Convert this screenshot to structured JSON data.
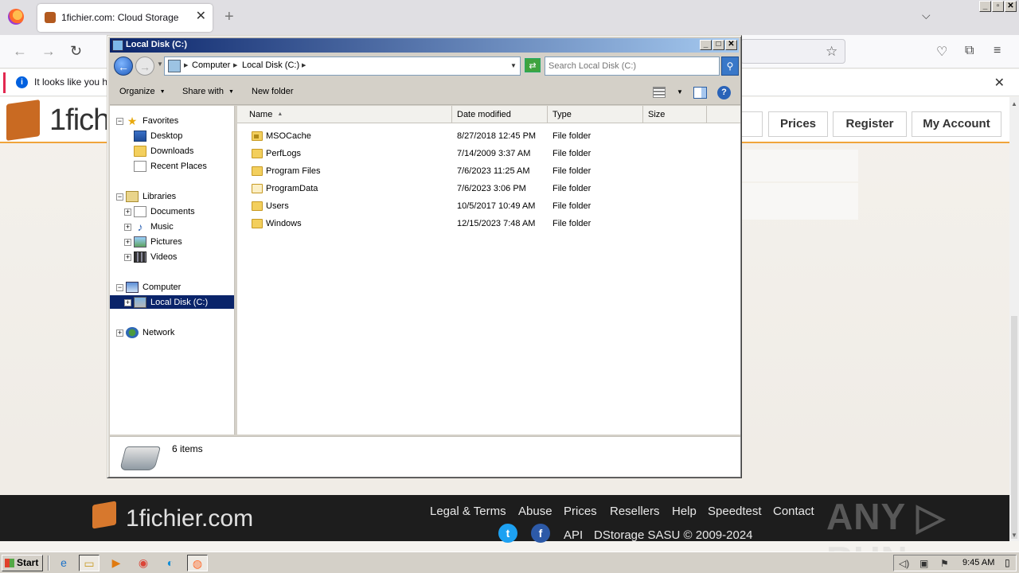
{
  "browser": {
    "tab_title": "1fichier.com: Cloud Storage",
    "tab_close": "✕",
    "new_tab": "+",
    "tab_list": "⌵",
    "info_text": "It looks like you ha",
    "info_close": "✕"
  },
  "os_window_controls": [
    "_",
    "▫",
    "✕"
  ],
  "site": {
    "logo_text": "1fich",
    "nav": [
      "Prices",
      "Register",
      "My Account"
    ],
    "footer": {
      "logo_text": "1fichier.com",
      "links": [
        "Legal & Terms",
        "Abuse",
        "Prices",
        "Resellers",
        "Help",
        "Speedtest",
        "Contact"
      ],
      "api": "API",
      "copyright": "DStorage SASU © 2009-2024",
      "twitter": "t",
      "facebook": "f"
    },
    "watermark": "ANY ▷ RUN"
  },
  "explorer": {
    "title": "Local Disk (C:)",
    "title_buttons": [
      "_",
      "□",
      "✕"
    ],
    "breadcrumb": [
      "Computer",
      "Local Disk (C:)"
    ],
    "search_placeholder": "Search Local Disk (C:)",
    "toolbar": {
      "organize": "Organize",
      "share_with": "Share with",
      "new_folder": "New folder"
    },
    "nav_tree": {
      "favorites": "Favorites",
      "desktop": "Desktop",
      "downloads": "Downloads",
      "recent_places": "Recent Places",
      "libraries": "Libraries",
      "documents": "Documents",
      "music": "Music",
      "pictures": "Pictures",
      "videos": "Videos",
      "computer": "Computer",
      "local_disk": "Local Disk (C:)",
      "network": "Network"
    },
    "columns": [
      "Name",
      "Date modified",
      "Type",
      "Size"
    ],
    "files": [
      {
        "name": "MSOCache",
        "date": "8/27/2018 12:45 PM",
        "type": "File folder",
        "size": ""
      },
      {
        "name": "PerfLogs",
        "date": "7/14/2009 3:37 AM",
        "type": "File folder",
        "size": ""
      },
      {
        "name": "Program Files",
        "date": "7/6/2023 11:25 AM",
        "type": "File folder",
        "size": ""
      },
      {
        "name": "ProgramData",
        "date": "7/6/2023 3:06 PM",
        "type": "File folder",
        "size": ""
      },
      {
        "name": "Users",
        "date": "10/5/2017 10:49 AM",
        "type": "File folder",
        "size": ""
      },
      {
        "name": "Windows",
        "date": "12/15/2023 7:48 AM",
        "type": "File folder",
        "size": ""
      }
    ],
    "status": "6 items"
  },
  "taskbar": {
    "start": "Start",
    "clock": "9:45 AM"
  }
}
